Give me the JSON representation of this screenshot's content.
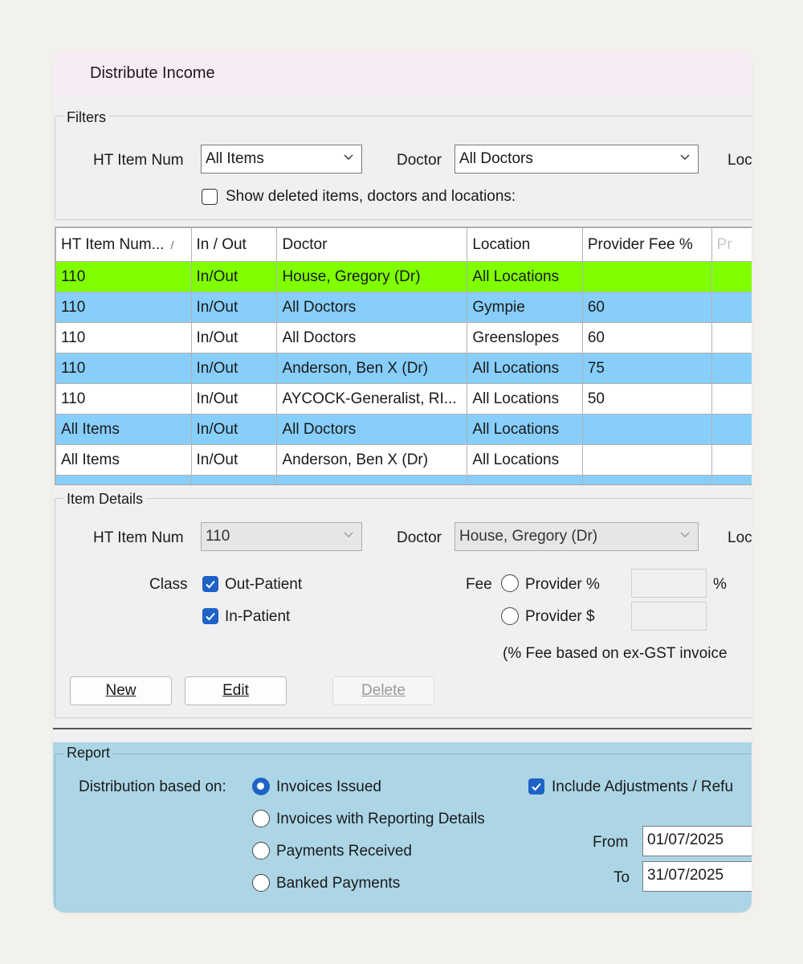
{
  "window": {
    "title": "Distribute Income"
  },
  "filters": {
    "legend": "Filters",
    "item_num_label": "HT Item Num",
    "item_num_value": "All Items",
    "doctor_label": "Doctor",
    "doctor_value": "All Doctors",
    "location_label_partial": "Loc",
    "show_deleted_label": "Show deleted items, doctors and locations:",
    "show_deleted_checked": false
  },
  "grid": {
    "columns": [
      "HT Item Num...",
      "In / Out",
      "Doctor",
      "Location",
      "Provider Fee %",
      "Pr"
    ],
    "sort_mark": "/",
    "rows": [
      {
        "cells": [
          "110",
          "In/Out",
          "House, Gregory (Dr)",
          "All Locations",
          ""
        ],
        "style": "green"
      },
      {
        "cells": [
          "110",
          "In/Out",
          "All Doctors",
          "Gympie",
          "60"
        ],
        "style": "blue"
      },
      {
        "cells": [
          "110",
          "In/Out",
          "All Doctors",
          "Greenslopes",
          "60"
        ],
        "style": "white"
      },
      {
        "cells": [
          "110",
          "In/Out",
          "Anderson, Ben X (Dr)",
          "All Locations",
          "75"
        ],
        "style": "blue"
      },
      {
        "cells": [
          "110",
          "In/Out",
          "AYCOCK-Generalist, RI...",
          "All Locations",
          "50"
        ],
        "style": "white"
      },
      {
        "cells": [
          "All Items",
          "In/Out",
          "All Doctors",
          "All Locations",
          ""
        ],
        "style": "blue"
      },
      {
        "cells": [
          "All Items",
          "In/Out",
          "Anderson, Ben X (Dr)",
          "All Locations",
          ""
        ],
        "style": "white"
      }
    ]
  },
  "details": {
    "legend": "Item Details",
    "item_num_label": "HT Item Num",
    "item_num_value": "110",
    "doctor_label": "Doctor",
    "doctor_value": "House, Gregory (Dr)",
    "location_label_partial": "Loc",
    "class_label": "Class",
    "out_patient_label": "Out-Patient",
    "out_patient_checked": true,
    "in_patient_label": "In-Patient",
    "in_patient_checked": true,
    "fee_label": "Fee",
    "provider_pct_label": "Provider %",
    "pct_symbol": "%",
    "provider_dollar_label": "Provider $",
    "fee_note": "(% Fee based on ex-GST invoice",
    "new_label": "New",
    "edit_label": "Edit",
    "delete_label": "Delete"
  },
  "report": {
    "legend": "Report",
    "distribution_label": "Distribution based on:",
    "options": [
      "Invoices Issued",
      "Invoices with Reporting Details",
      "Payments Received",
      "Banked Payments"
    ],
    "selected_option": "Invoices Issued",
    "include_adjustments_label": "Include Adjustments / Refu",
    "include_adjustments_checked": true,
    "from_label": "From",
    "from_value": "01/07/2025",
    "to_label": "To",
    "to_value": "31/07/2025"
  },
  "colors": {
    "title_bar": "#f7ecf3",
    "row_selected": "#7fff00",
    "row_alt": "#87cefa",
    "report_bg": "#acd6e6",
    "accent": "#1e62c6"
  }
}
